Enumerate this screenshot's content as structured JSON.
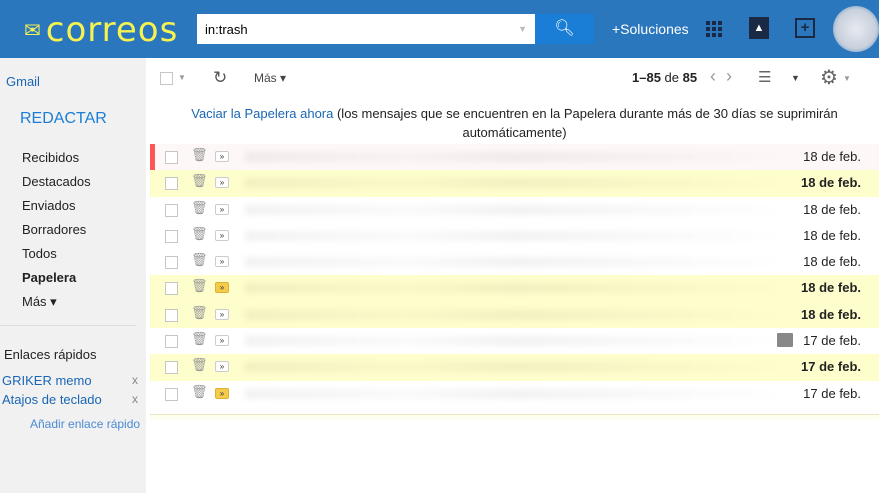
{
  "header": {
    "logo": "correos",
    "search_value": "in:trash",
    "solutions": "+Soluciones"
  },
  "sidebar": {
    "account": "Gmail",
    "compose": "REDACTAR",
    "items": [
      {
        "label": "Recibidos"
      },
      {
        "label": "Destacados"
      },
      {
        "label": "Enviados"
      },
      {
        "label": "Borradores"
      },
      {
        "label": "Todos"
      },
      {
        "label": "Papelera"
      },
      {
        "label": "Más ▾"
      }
    ],
    "quick_links_title": "Enlaces rápidos",
    "quick_links": [
      {
        "label": "GRIKER memo",
        "remove": "x"
      },
      {
        "label": "Atajos de teclado",
        "remove": "x"
      }
    ],
    "add_quick_link": "Añadir enlace rápido"
  },
  "toolbar": {
    "more": "Más ▾",
    "range": "1–85",
    "of": "de",
    "total": "85"
  },
  "notice": {
    "link": "Vaciar la Papelera ahora",
    "text": " (los mensajes que se encuentren en la Papelera durante más de 30 días se suprimirán automáticamente)"
  },
  "emails": [
    {
      "date": "18 de feb.",
      "unread": false,
      "important": false
    },
    {
      "date": "18 de feb.",
      "unread": true,
      "important": false
    },
    {
      "date": "18 de feb.",
      "unread": false,
      "important": false
    },
    {
      "date": "18 de feb.",
      "unread": false,
      "important": false
    },
    {
      "date": "18 de feb.",
      "unread": false,
      "important": false
    },
    {
      "date": "18 de feb.",
      "unread": true,
      "important": true
    },
    {
      "date": "18 de feb.",
      "unread": true,
      "important": false
    },
    {
      "date": "17 de feb.",
      "unread": false,
      "important": false,
      "attachment": true
    },
    {
      "date": "17 de feb.",
      "unread": true,
      "important": false
    },
    {
      "date": "17 de feb.",
      "unread": false,
      "important": true
    }
  ]
}
